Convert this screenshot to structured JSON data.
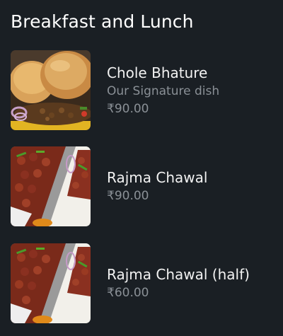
{
  "section": {
    "title": "Breakfast and Lunch"
  },
  "items": [
    {
      "name": "Chole Bhature",
      "description": "Our Signature dish",
      "price": "₹90.00",
      "image_icon": "chole-bhature-photo"
    },
    {
      "name": "Rajma Chawal",
      "price": "₹90.00",
      "image_icon": "rajma-chawal-photo"
    },
    {
      "name": "Rajma Chawal (half)",
      "price": "₹60.00",
      "image_icon": "rajma-chawal-photo"
    }
  ],
  "colors": {
    "background": "#1a1f24",
    "title_text": "#ffffff",
    "item_name": "#f2f2f2",
    "secondary_text": "#8a9096"
  }
}
